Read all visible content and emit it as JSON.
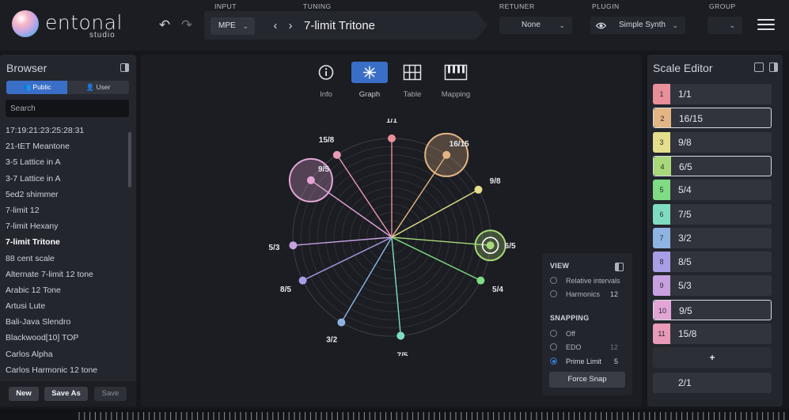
{
  "app": {
    "logo_text": "entonal",
    "logo_sub": "studio"
  },
  "header": {
    "input_label": "INPUT",
    "tuning_label": "TUNING",
    "retuner_label": "RETUNER",
    "plugin_label": "PLUGIN",
    "group_label": "GROUP",
    "input_value": "MPE",
    "tuning_name": "7-limit Tritone",
    "retuner_value": "None",
    "plugin_value": "Simple Synth",
    "group_value": ""
  },
  "browser": {
    "title": "Browser",
    "public_tab": "Public",
    "user_tab": "User",
    "search_placeholder": "Search",
    "items": [
      "17:19:21:23:25:28:31",
      "21-tET Meantone",
      "3-5 Lattice in A",
      "3-7 Lattice in A",
      "5ed2 shimmer",
      "7-limit 12",
      "7-limit Hexany",
      "7-limit Tritone",
      "88 cent scale",
      "Alternate 7-limit 12 tone",
      "Arabic 12 Tone",
      "Artusi Lute",
      "Bali-Java Slendro",
      "Blackwood[10] TOP",
      "Carlos Alpha",
      "Carlos Harmonic 12 tone"
    ],
    "active_item": "7-limit Tritone",
    "new_label": "New",
    "save_as_label": "Save As",
    "save_label": "Save"
  },
  "view_tabs": {
    "info": "Info",
    "graph": "Graph",
    "table": "Table",
    "mapping": "Mapping",
    "active": "Graph"
  },
  "graph": {
    "nodes": [
      {
        "label": "1/1",
        "angle_deg": 0,
        "color": "#e88f9a",
        "highlight": false
      },
      {
        "label": "16/15",
        "angle_deg": 33.6,
        "color": "#e3b585",
        "highlight": true
      },
      {
        "label": "9/8",
        "angle_deg": 61.2,
        "color": "#e3df8a",
        "highlight": false
      },
      {
        "label": "6/5",
        "angle_deg": 94.7,
        "color": "#a8d87a",
        "highlight": true
      },
      {
        "label": "5/4",
        "angle_deg": 115.9,
        "color": "#7fdc84",
        "highlight": false
      },
      {
        "label": "7/5",
        "angle_deg": 174.8,
        "color": "#7fdcc0",
        "highlight": false
      },
      {
        "label": "3/2",
        "angle_deg": 210.6,
        "color": "#8fb4e3",
        "highlight": false
      },
      {
        "label": "8/5",
        "angle_deg": 244.1,
        "color": "#a89ee6",
        "highlight": false
      },
      {
        "label": "5/3",
        "angle_deg": 265.3,
        "color": "#c7a0e0",
        "highlight": false
      },
      {
        "label": "9/5",
        "angle_deg": 305.2,
        "color": "#e2a5d6",
        "highlight": true
      },
      {
        "label": "15/8",
        "angle_deg": 326.4,
        "color": "#e89ab6",
        "highlight": false
      }
    ]
  },
  "view_panel": {
    "view_title": "VIEW",
    "relative_intervals": "Relative intervals",
    "harmonics": "Harmonics",
    "harmonics_value": "12",
    "snapping_title": "SNAPPING",
    "off": "Off",
    "edo": "EDO",
    "edo_value": "12",
    "prime_limit": "Prime Limit",
    "prime_limit_value": "5",
    "snapping_selected": "Prime Limit",
    "force_snap": "Force Snap"
  },
  "scale_editor": {
    "title": "Scale Editor",
    "rows": [
      {
        "num": "1",
        "ratio": "1/1",
        "color": "#e88f9a",
        "highlight": false
      },
      {
        "num": "2",
        "ratio": "16/15",
        "color": "#e3b585",
        "highlight": true
      },
      {
        "num": "3",
        "ratio": "9/8",
        "color": "#e3df8a",
        "highlight": false
      },
      {
        "num": "4",
        "ratio": "6/5",
        "color": "#a8d87a",
        "highlight": true
      },
      {
        "num": "5",
        "ratio": "5/4",
        "color": "#7fdc84",
        "highlight": false
      },
      {
        "num": "6",
        "ratio": "7/5",
        "color": "#7fdcc0",
        "highlight": false
      },
      {
        "num": "7",
        "ratio": "3/2",
        "color": "#8fb4e3",
        "highlight": false
      },
      {
        "num": "8",
        "ratio": "8/5",
        "color": "#a89ee6",
        "highlight": false
      },
      {
        "num": "9",
        "ratio": "5/3",
        "color": "#c7a0e0",
        "highlight": false
      },
      {
        "num": "10",
        "ratio": "9/5",
        "color": "#e2a5d6",
        "highlight": true
      },
      {
        "num": "11",
        "ratio": "15/8",
        "color": "#e89ab6",
        "highlight": false
      }
    ],
    "add_label": "+",
    "period": "2/1"
  }
}
